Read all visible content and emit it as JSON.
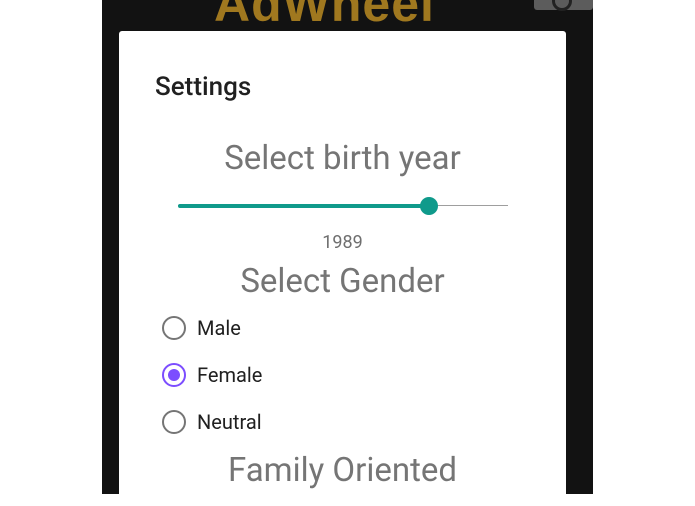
{
  "app": {
    "logo_text": "AdWheel",
    "brand_color": "#a0781f"
  },
  "dialog": {
    "title": "Settings",
    "birth_year": {
      "heading": "Select birth year",
      "value": "1989",
      "slider_fraction": 0.76,
      "accent_color": "#0f9a8b"
    },
    "gender": {
      "heading": "Select Gender",
      "accent_color": "#7c4dff",
      "options": [
        {
          "label": "Male",
          "checked": false
        },
        {
          "label": "Female",
          "checked": true
        },
        {
          "label": "Neutral",
          "checked": false
        }
      ]
    },
    "family": {
      "heading": "Family Oriented"
    }
  },
  "icons": {
    "corner": "circle-icon"
  }
}
